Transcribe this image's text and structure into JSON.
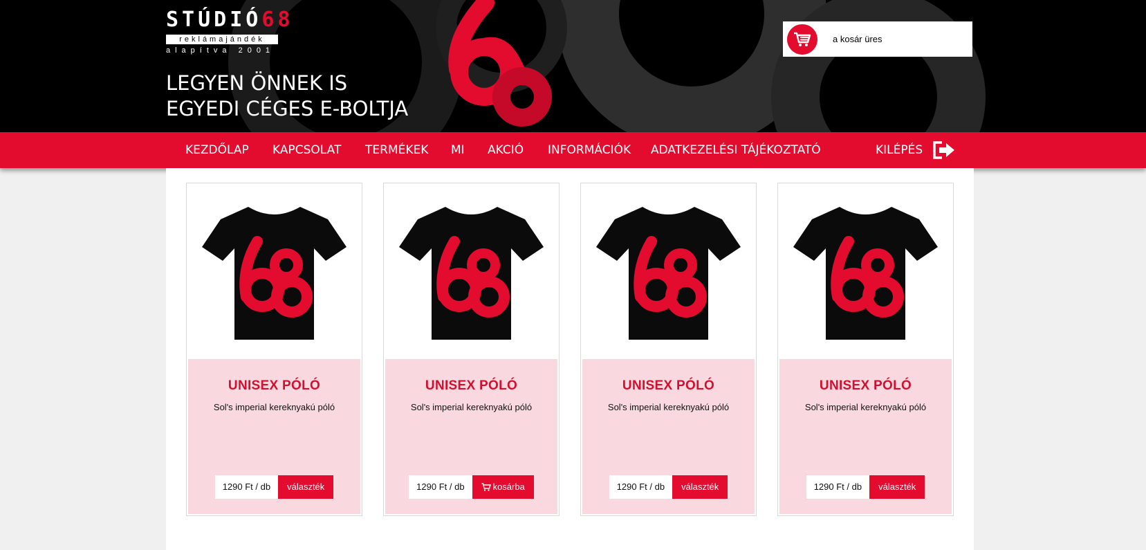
{
  "header": {
    "logo": {
      "name_prefix": "STÚDIÓ",
      "name_number": "68",
      "sub1": "reklámajándék",
      "sub2": "alapítva 2001"
    },
    "tagline_line1": "LEGYEN ÖNNEK IS",
    "tagline_line2": "EGYEDI CÉGES E-BOLTJA",
    "cart": {
      "icon": "cart-icon",
      "text": "a kosár üres"
    }
  },
  "nav": {
    "items": [
      "KEZDŐLAP",
      "KAPCSOLAT",
      "TERMÉKEK",
      "MI",
      "AKCIÓ",
      "INFORMÁCIÓK",
      "ADATKEZELÉSI TÁJÉKOZTATÓ"
    ],
    "logout_label": "KILÉPÉS",
    "logout_icon": "logout-icon"
  },
  "products": [
    {
      "title": "UNISEX PÓLÓ",
      "description": "Sol's imperial kereknyakú póló",
      "price": "1290 Ft / db",
      "button": "választék",
      "button_icon": ""
    },
    {
      "title": "UNISEX PÓLÓ",
      "description": "Sol's imperial kereknyakú póló",
      "price": "1290 Ft / db",
      "button": "kosárba",
      "button_icon": "cart-icon"
    },
    {
      "title": "UNISEX PÓLÓ",
      "description": "Sol's imperial kereknyakú póló",
      "price": "1290 Ft / db",
      "button": "választék",
      "button_icon": ""
    },
    {
      "title": "UNISEX PÓLÓ",
      "description": "Sol's imperial kereknyakú póló",
      "price": "1290 Ft / db",
      "button": "választék",
      "button_icon": ""
    }
  ],
  "colors": {
    "accent": "#e30b2e",
    "card_body": "#f9d9df",
    "header_bg": "#000000"
  }
}
